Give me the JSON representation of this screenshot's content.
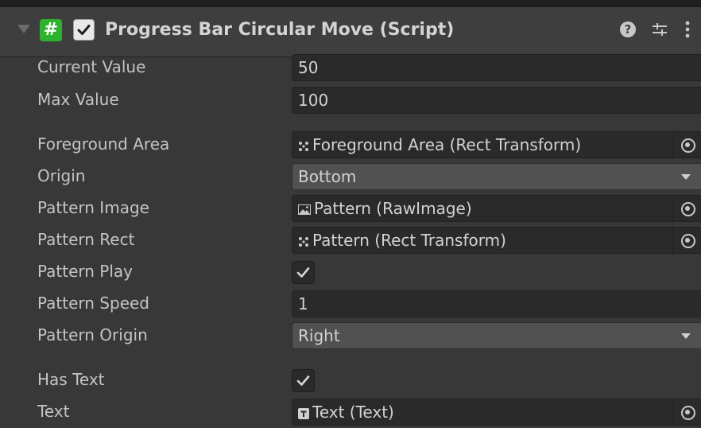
{
  "component": {
    "title": "Progress Bar Circular Move (Script)",
    "icons": {
      "script": "script-hash-icon",
      "help": "help-icon",
      "presets": "presets-icon",
      "menu": "context-menu-icon"
    },
    "accent": "#2cb22c"
  },
  "fields": {
    "current_value": {
      "label": "Current Value",
      "value": "50"
    },
    "max_value": {
      "label": "Max Value",
      "value": "100"
    },
    "foreground_area": {
      "label": "Foreground Area",
      "value": "Foreground Area (Rect Transform)",
      "icon": "rect-transform-icon"
    },
    "origin": {
      "label": "Origin",
      "value": "Bottom"
    },
    "pattern_image": {
      "label": "Pattern Image",
      "value": "Pattern (RawImage)",
      "icon": "raw-image-icon"
    },
    "pattern_rect": {
      "label": "Pattern Rect",
      "value": "Pattern (Rect Transform)",
      "icon": "rect-transform-icon"
    },
    "pattern_play": {
      "label": "Pattern Play",
      "checked": true
    },
    "pattern_speed": {
      "label": "Pattern Speed",
      "value": "1"
    },
    "pattern_origin": {
      "label": "Pattern Origin",
      "value": "Right"
    },
    "has_text": {
      "label": "Has Text",
      "checked": true
    },
    "text": {
      "label": "Text",
      "value": "Text (Text)",
      "icon": "text-component-icon"
    }
  }
}
